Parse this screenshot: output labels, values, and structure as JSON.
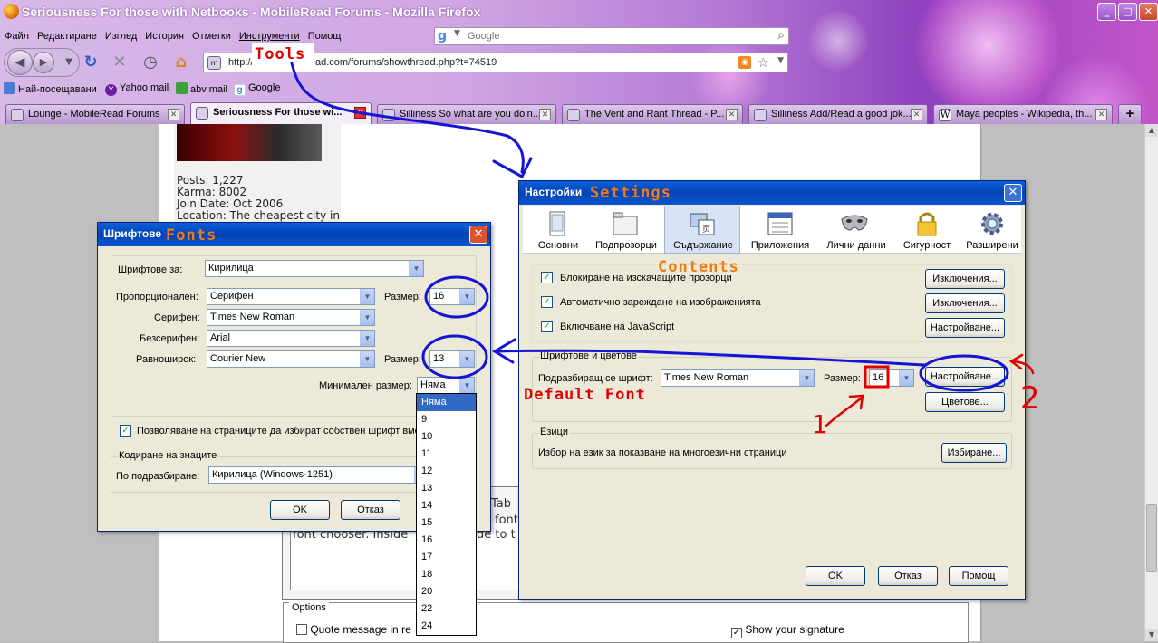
{
  "window": {
    "title": "Seriousness For those with Netbooks - MobileRead Forums - Mozilla Firefox",
    "minimize": "_",
    "maximize": "□",
    "close": "✕"
  },
  "menu": [
    "Файл",
    "Редактиране",
    "Изглед",
    "История",
    "Отметки",
    "Инструменти",
    "Помощ"
  ],
  "search": {
    "placeholder": "Google",
    "engine_icon": "google-icon"
  },
  "address": {
    "url": "http://www.mobileread.com/forums/showthread.php?t=74519"
  },
  "bookmarks": [
    "Най-посещавани",
    "Yahoo mail",
    "abv mail",
    "Google"
  ],
  "tabs": [
    "Lounge - MobileRead Forums",
    "Seriousness For those wi...",
    "Silliness So what are you doin...",
    "The Vent and Rant Thread - P...",
    "Silliness Add/Read a good jok...",
    "Maya peoples - Wikipedia, th..."
  ],
  "new_tab": "+",
  "post": {
    "posts": "Posts: 1,227",
    "karma": "Karma: 8002",
    "join_date": "Join Date: Oct 2006",
    "location": "Location: The cheapest city in"
  },
  "editor_fragments": [
    "Tab",
    "font",
    "font chooser. Inside",
    "de to t"
  ],
  "options": {
    "legend": "Options",
    "quote": "Quote message in re",
    "signature": "Show your signature"
  },
  "settings": {
    "title": "Настройки",
    "toolbar": [
      "Основни",
      "Подпрозорци",
      "Съдържание",
      "Приложения",
      "Лични данни",
      "Сигурност",
      "Разширени"
    ],
    "block_popups": "Блокиране на изскачащите прозорци",
    "load_images": "Автоматично зареждане на изображенията",
    "enable_js": "Включване на JavaScript",
    "exceptions_1": "Изключения...",
    "exceptions_2": "Изключения...",
    "advanced_js": "Настройване...",
    "fonts_group": "Шрифтове и цветове",
    "default_font_label": "Подразбиращ се шрифт:",
    "default_font": "Times New Roman",
    "size_label": "Размер:",
    "size": "16",
    "advanced_fonts": "Настройване...",
    "colors": "Цветове...",
    "languages_group": "Езици",
    "languages_text": "Избор на език за показване на многоезични страници",
    "choose": "Избиране...",
    "ok": "OK",
    "cancel": "Отказ",
    "help": "Помощ"
  },
  "fonts": {
    "title": "Шрифтове",
    "fonts_for_label": "Шрифтове за:",
    "fonts_for": "Кирилица",
    "proportional_label": "Пропорционален:",
    "proportional": "Серифен",
    "size_label_1": "Размер:",
    "size_1": "16",
    "serif_label": "Серифен:",
    "serif": "Times New Roman",
    "sans_label": "Безсерифен:",
    "sans": "Arial",
    "mono_label": "Равноширок:",
    "mono": "Courier New",
    "size_label_2": "Размер:",
    "size_2": "13",
    "min_size_label": "Минимален размер:",
    "min_size": "Няма",
    "allow_pages": "Позволяване на страниците да избират собствен шрифт вме",
    "encoding_group": "Кодиране на знаците",
    "default_label": "По подразбиране:",
    "encoding": "Кирилица (Windows-1251)",
    "ok": "OK",
    "cancel": "Отказ"
  },
  "min_size_options": [
    "Няма",
    "9",
    "10",
    "11",
    "12",
    "13",
    "14",
    "15",
    "16",
    "17",
    "18",
    "20",
    "22",
    "24"
  ],
  "annotations": {
    "tools": "Tools",
    "settings": "Settings",
    "fonts": "Fonts",
    "contents": "Contents",
    "default_font": "Default Font",
    "step_1": "1",
    "step_2": "2"
  },
  "colors": {
    "chrome_purple": "#b47ad6",
    "xp_title_blue": "#0a5fd8",
    "dialog_face": "#ece9d8",
    "annotation_blue": "#1414d4",
    "annotation_red": "#e00000",
    "annotation_orange": "#f07a13",
    "selection": "#316ac5"
  }
}
